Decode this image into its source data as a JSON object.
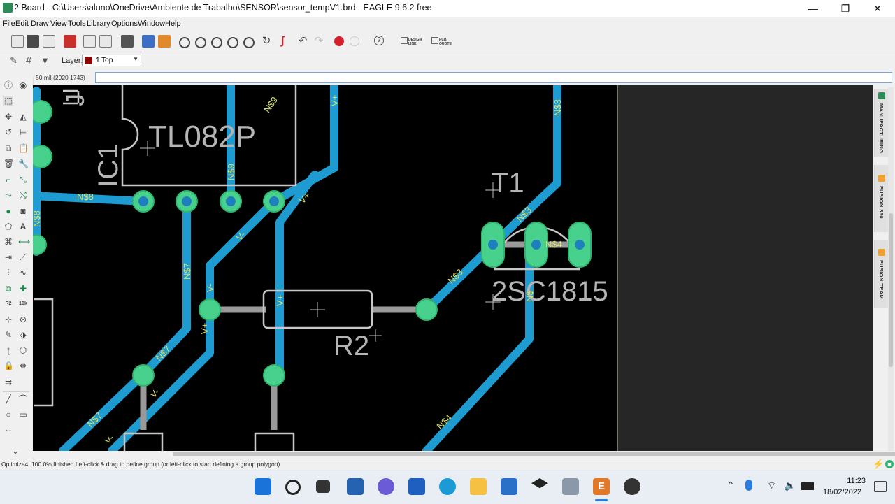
{
  "window": {
    "title": "2 Board - C:\\Users\\aluno\\OneDrive\\Ambiente de Trabalho\\SENSOR\\sensor_tempV1.brd - EAGLE 9.6.2 free",
    "controls": [
      "—",
      "❐",
      "✕"
    ]
  },
  "menu": [
    "File",
    "Edit",
    "Draw",
    "View",
    "Tools",
    "Library",
    "Options",
    "Window",
    "Help"
  ],
  "toolbar": {
    "design_link_label": "DESIGN LINK",
    "pcb_quote_label": "PCB QUOTE",
    "help_label": "?"
  },
  "layer": {
    "label": "Layer:",
    "selected": "1 Top",
    "color": "#8b0000"
  },
  "coords": {
    "readout": "50 mil (2920 1743)",
    "command_value": ""
  },
  "canvas": {
    "background": "#000000",
    "copper_color": "#1e9bd0",
    "pad_color": "#47d18c",
    "silk_color": "#c8c8c8",
    "labels": {
      "tl082p": "TL082P",
      "ic1": "IC1",
      "j": "J",
      "t1": "T1",
      "part_2sc1815": "2SC1815",
      "r2": "R2"
    },
    "net_labels": [
      "N$9",
      "V+",
      "N$3",
      "N$9",
      "N$8",
      "V+",
      "N$3",
      "N$4",
      "V-",
      "N$7",
      "V-",
      "N$3",
      "V+",
      "V+",
      "N$7",
      "N$8",
      "V-",
      "N$7",
      "V-",
      "N$4",
      "N$"
    ]
  },
  "right_panel": {
    "tabs": [
      "MANUFACTURING",
      "FUSION 360",
      "FUSION TEAM"
    ]
  },
  "status": {
    "text": "Optimize4: 100.0% finished Left-click & drag to define group (or left-click to start defining a group polygon)"
  },
  "taskbar": {
    "apps": [
      "windows-start",
      "search",
      "task-view",
      "snap-layouts",
      "teams-chat",
      "store",
      "edge",
      "file-explorer",
      "mail",
      "dropbox",
      "network-app",
      "eagle",
      "obs"
    ],
    "tray_icons": [
      "chevron-up",
      "microphone",
      "wifi",
      "volume",
      "battery"
    ],
    "time": "11:23",
    "date": "18/02/2022"
  }
}
